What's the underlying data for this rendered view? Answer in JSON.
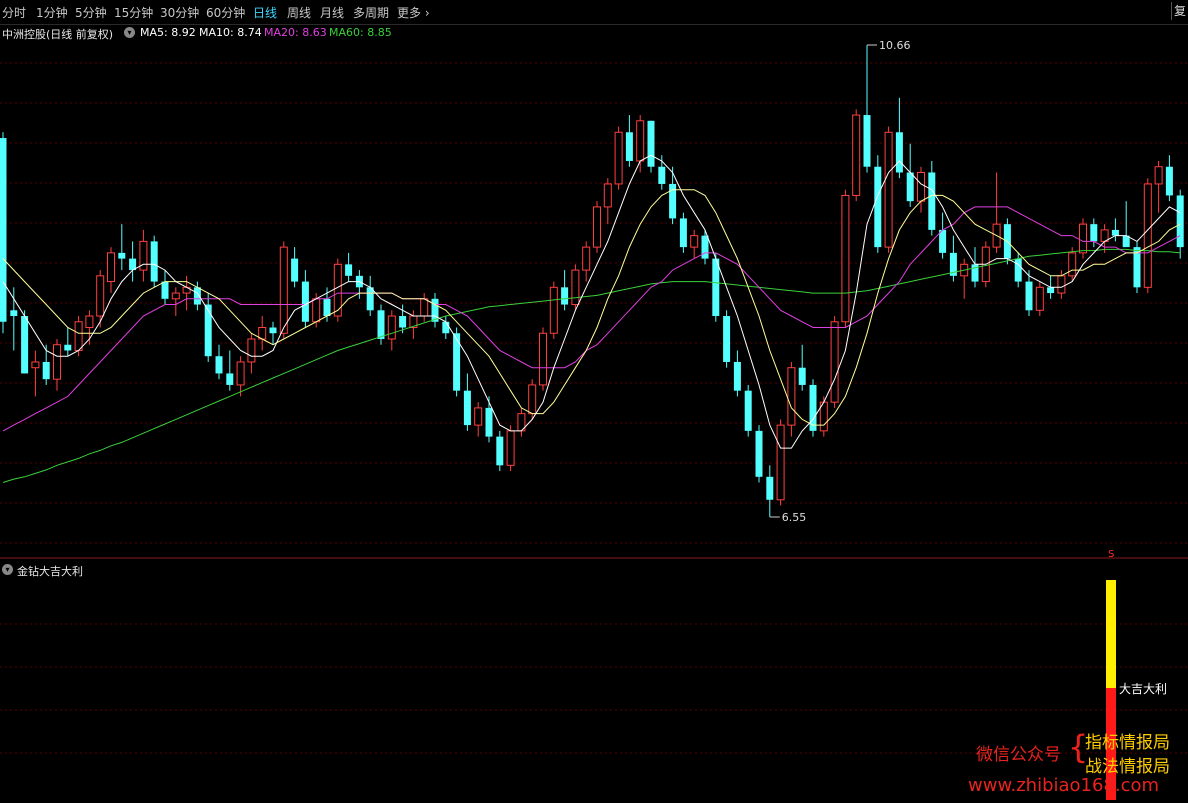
{
  "toolbar": {
    "tabs": [
      "分时",
      "1分钟",
      "5分钟",
      "15分钟",
      "30分钟",
      "60分钟",
      "日线",
      "周线",
      "月线",
      "多周期",
      "更多"
    ],
    "active_tab": "日线",
    "more_chevron": "›",
    "restore_label": "复"
  },
  "main_panel": {
    "title": "中洲控股(日线 前复权)",
    "toggle_icon": "circle-chevron-icon",
    "indicators": [
      {
        "label": "MA5: 8.92",
        "color": "#ffffff"
      },
      {
        "label": "MA10: 8.74",
        "color": "#ffffff"
      },
      {
        "label": "MA20: 8.63",
        "color": "#e040e0"
      },
      {
        "label": "MA60: 8.85",
        "color": "#3ad13a"
      }
    ],
    "high_label": "10.66",
    "low_label": "6.55"
  },
  "sub_panel": {
    "title": "金钻大吉大利",
    "signal_marker": "S",
    "bar_label": "大吉大利",
    "signal_colors": {
      "top": "#ffee00",
      "bottom": "#ff1a1a"
    }
  },
  "watermark": {
    "left": "微信公众号",
    "right_top": "指标情报局",
    "right_bottom": "战法情报局",
    "url": "www.zhibiao168.com"
  },
  "colors": {
    "up": "#ff4040",
    "down": "#54ffff",
    "ma5": "#ffffff",
    "ma10": "#ffff99",
    "ma20": "#e040e0",
    "ma60": "#3ad13a",
    "grid": "#5a0000"
  },
  "chart_data": {
    "type": "candlestick",
    "title": "中洲控股(日线 前复权)",
    "price_high": 10.66,
    "price_low": 6.55,
    "candles": [
      [
        9.85,
        9.9,
        8.15,
        8.25
      ],
      [
        8.35,
        8.55,
        8.0,
        8.3
      ],
      [
        8.3,
        8.35,
        7.8,
        7.8
      ],
      [
        7.85,
        8.0,
        7.6,
        7.9
      ],
      [
        7.9,
        8.05,
        7.7,
        7.75
      ],
      [
        7.75,
        8.1,
        7.65,
        8.05
      ],
      [
        8.05,
        8.2,
        7.95,
        8.0
      ],
      [
        8.0,
        8.3,
        7.95,
        8.25
      ],
      [
        8.2,
        8.35,
        8.05,
        8.3
      ],
      [
        8.3,
        8.7,
        8.2,
        8.65
      ],
      [
        8.6,
        8.9,
        8.5,
        8.85
      ],
      [
        8.85,
        9.1,
        8.7,
        8.8
      ],
      [
        8.8,
        8.95,
        8.6,
        8.7
      ],
      [
        8.7,
        9.05,
        8.6,
        8.95
      ],
      [
        8.95,
        9.0,
        8.55,
        8.6
      ],
      [
        8.6,
        8.7,
        8.4,
        8.45
      ],
      [
        8.45,
        8.55,
        8.3,
        8.5
      ],
      [
        8.5,
        8.65,
        8.35,
        8.55
      ],
      [
        8.55,
        8.6,
        8.35,
        8.4
      ],
      [
        8.4,
        8.5,
        7.9,
        7.95
      ],
      [
        7.95,
        8.05,
        7.75,
        7.8
      ],
      [
        7.8,
        8.0,
        7.65,
        7.7
      ],
      [
        7.7,
        7.95,
        7.6,
        7.9
      ],
      [
        7.9,
        8.15,
        7.8,
        8.1
      ],
      [
        8.1,
        8.3,
        8.0,
        8.2
      ],
      [
        8.2,
        8.25,
        8.05,
        8.15
      ],
      [
        8.15,
        8.95,
        8.1,
        8.9
      ],
      [
        8.8,
        8.9,
        8.55,
        8.6
      ],
      [
        8.6,
        8.7,
        8.2,
        8.25
      ],
      [
        8.25,
        8.5,
        8.2,
        8.45
      ],
      [
        8.45,
        8.55,
        8.25,
        8.3
      ],
      [
        8.3,
        8.8,
        8.25,
        8.75
      ],
      [
        8.75,
        8.85,
        8.6,
        8.65
      ],
      [
        8.65,
        8.7,
        8.45,
        8.55
      ],
      [
        8.55,
        8.65,
        8.3,
        8.35
      ],
      [
        8.35,
        8.4,
        8.05,
        8.1
      ],
      [
        8.1,
        8.35,
        8.0,
        8.3
      ],
      [
        8.3,
        8.4,
        8.15,
        8.2
      ],
      [
        8.2,
        8.35,
        8.1,
        8.3
      ],
      [
        8.3,
        8.5,
        8.25,
        8.45
      ],
      [
        8.45,
        8.5,
        8.2,
        8.25
      ],
      [
        8.25,
        8.3,
        8.1,
        8.15
      ],
      [
        8.15,
        8.2,
        7.6,
        7.65
      ],
      [
        7.65,
        7.8,
        7.3,
        7.35
      ],
      [
        7.35,
        7.55,
        7.25,
        7.5
      ],
      [
        7.5,
        7.6,
        7.2,
        7.25
      ],
      [
        7.25,
        7.3,
        6.95,
        7.0
      ],
      [
        7.0,
        7.35,
        6.95,
        7.3
      ],
      [
        7.3,
        7.5,
        7.25,
        7.45
      ],
      [
        7.45,
        7.75,
        7.4,
        7.7
      ],
      [
        7.7,
        8.2,
        7.65,
        8.15
      ],
      [
        8.15,
        8.6,
        8.1,
        8.55
      ],
      [
        8.55,
        8.7,
        8.35,
        8.4
      ],
      [
        8.4,
        8.75,
        8.35,
        8.7
      ],
      [
        8.7,
        8.95,
        8.6,
        8.9
      ],
      [
        8.9,
        9.3,
        8.85,
        9.25
      ],
      [
        9.25,
        9.5,
        9.1,
        9.45
      ],
      [
        9.45,
        9.95,
        9.4,
        9.9
      ],
      [
        9.9,
        10.05,
        9.6,
        9.65
      ],
      [
        9.65,
        10.05,
        9.55,
        10.0
      ],
      [
        10.0,
        10.0,
        9.55,
        9.6
      ],
      [
        9.6,
        9.7,
        9.4,
        9.45
      ],
      [
        9.45,
        9.6,
        9.1,
        9.15
      ],
      [
        9.15,
        9.2,
        8.85,
        8.9
      ],
      [
        8.9,
        9.05,
        8.8,
        9.0
      ],
      [
        9.0,
        9.05,
        8.75,
        8.8
      ],
      [
        8.8,
        8.85,
        8.25,
        8.3
      ],
      [
        8.3,
        8.35,
        7.85,
        7.9
      ],
      [
        7.9,
        8.0,
        7.6,
        7.65
      ],
      [
        7.65,
        7.7,
        7.25,
        7.3
      ],
      [
        7.3,
        7.35,
        6.85,
        6.9
      ],
      [
        6.9,
        7.0,
        6.55,
        6.7
      ],
      [
        6.7,
        7.4,
        6.65,
        7.35
      ],
      [
        7.35,
        7.9,
        7.25,
        7.85
      ],
      [
        7.85,
        8.05,
        7.65,
        7.7
      ],
      [
        7.7,
        7.75,
        7.25,
        7.3
      ],
      [
        7.3,
        7.6,
        7.25,
        7.55
      ],
      [
        7.55,
        8.3,
        7.5,
        8.25
      ],
      [
        8.25,
        9.4,
        8.2,
        9.35
      ],
      [
        9.35,
        10.1,
        9.3,
        10.05
      ],
      [
        10.05,
        10.66,
        9.55,
        9.6
      ],
      [
        9.6,
        9.7,
        8.85,
        8.9
      ],
      [
        8.9,
        9.95,
        8.85,
        9.9
      ],
      [
        9.9,
        10.2,
        9.5,
        9.55
      ],
      [
        9.55,
        9.8,
        9.25,
        9.3
      ],
      [
        9.3,
        9.6,
        9.2,
        9.55
      ],
      [
        9.55,
        9.65,
        9.0,
        9.05
      ],
      [
        9.05,
        9.2,
        8.8,
        8.85
      ],
      [
        8.85,
        9.0,
        8.6,
        8.65
      ],
      [
        8.65,
        8.8,
        8.45,
        8.75
      ],
      [
        8.75,
        8.9,
        8.55,
        8.6
      ],
      [
        8.6,
        8.95,
        8.55,
        8.9
      ],
      [
        8.9,
        9.55,
        8.85,
        9.1
      ],
      [
        9.1,
        9.15,
        8.75,
        8.8
      ],
      [
        8.8,
        8.85,
        8.55,
        8.6
      ],
      [
        8.6,
        8.7,
        8.3,
        8.35
      ],
      [
        8.35,
        8.6,
        8.3,
        8.55
      ],
      [
        8.55,
        8.65,
        8.45,
        8.5
      ],
      [
        8.5,
        8.7,
        8.45,
        8.65
      ],
      [
        8.65,
        8.9,
        8.6,
        8.85
      ],
      [
        8.85,
        9.15,
        8.8,
        9.1
      ],
      [
        9.1,
        9.15,
        8.9,
        8.95
      ],
      [
        8.95,
        9.1,
        8.85,
        9.05
      ],
      [
        9.05,
        9.15,
        8.95,
        9.0
      ],
      [
        9.0,
        9.3,
        8.95,
        8.9
      ],
      [
        8.9,
        8.95,
        8.5,
        8.55
      ],
      [
        8.55,
        9.5,
        8.5,
        9.45
      ],
      [
        9.45,
        9.65,
        9.2,
        9.6
      ],
      [
        9.6,
        9.7,
        9.3,
        9.35
      ],
      [
        9.35,
        9.4,
        8.8,
        8.9
      ]
    ],
    "ma": {
      "ma5": [
        8.6,
        8.45,
        8.3,
        8.15,
        8.0,
        7.95,
        7.95,
        8.0,
        8.1,
        8.25,
        8.45,
        8.6,
        8.7,
        8.75,
        8.75,
        8.7,
        8.6,
        8.55,
        8.5,
        8.35,
        8.2,
        8.1,
        8.0,
        7.95,
        7.95,
        8.0,
        8.2,
        8.35,
        8.4,
        8.45,
        8.5,
        8.55,
        8.6,
        8.6,
        8.55,
        8.45,
        8.4,
        8.35,
        8.3,
        8.3,
        8.3,
        8.25,
        8.1,
        7.95,
        7.75,
        7.55,
        7.35,
        7.3,
        7.3,
        7.4,
        7.55,
        7.85,
        8.1,
        8.35,
        8.55,
        8.75,
        8.95,
        9.2,
        9.45,
        9.65,
        9.7,
        9.65,
        9.55,
        9.35,
        9.2,
        9.05,
        8.8,
        8.55,
        8.3,
        8.0,
        7.7,
        7.35,
        7.15,
        7.15,
        7.3,
        7.4,
        7.55,
        7.75,
        8.0,
        8.5,
        9.1,
        9.35,
        9.55,
        9.65,
        9.55,
        9.45,
        9.4,
        9.25,
        9.05,
        8.9,
        8.75,
        8.75,
        8.8,
        8.8,
        8.75,
        8.65,
        8.6,
        8.55,
        8.55,
        8.6,
        8.75,
        8.85,
        8.95,
        9.0,
        9.0,
        8.95,
        9.05,
        9.15,
        9.25,
        9.2
      ],
      "ma10": [
        8.8,
        8.7,
        8.6,
        8.5,
        8.4,
        8.3,
        8.2,
        8.15,
        8.15,
        8.15,
        8.2,
        8.3,
        8.4,
        8.5,
        8.55,
        8.6,
        8.6,
        8.6,
        8.55,
        8.5,
        8.45,
        8.35,
        8.25,
        8.15,
        8.1,
        8.05,
        8.1,
        8.15,
        8.2,
        8.25,
        8.3,
        8.35,
        8.45,
        8.5,
        8.5,
        8.5,
        8.5,
        8.45,
        8.45,
        8.45,
        8.4,
        8.35,
        8.25,
        8.15,
        8.05,
        7.95,
        7.8,
        7.65,
        7.5,
        7.45,
        7.45,
        7.55,
        7.7,
        7.85,
        8.0,
        8.2,
        8.45,
        8.65,
        8.9,
        9.1,
        9.25,
        9.35,
        9.4,
        9.4,
        9.4,
        9.35,
        9.2,
        9.0,
        8.8,
        8.55,
        8.3,
        8.0,
        7.75,
        7.5,
        7.4,
        7.35,
        7.35,
        7.45,
        7.6,
        7.85,
        8.15,
        8.5,
        8.8,
        9.05,
        9.2,
        9.3,
        9.35,
        9.35,
        9.3,
        9.2,
        9.1,
        9.05,
        9.0,
        8.95,
        8.85,
        8.75,
        8.7,
        8.65,
        8.65,
        8.7,
        8.7,
        8.75,
        8.75,
        8.8,
        8.85,
        8.85,
        8.9,
        8.95,
        9.05,
        9.1
      ],
      "ma20": [
        7.3,
        7.35,
        7.4,
        7.45,
        7.5,
        7.55,
        7.6,
        7.7,
        7.8,
        7.9,
        8.0,
        8.1,
        8.2,
        8.3,
        8.35,
        8.4,
        8.4,
        8.45,
        8.45,
        8.45,
        8.45,
        8.45,
        8.4,
        8.4,
        8.4,
        8.4,
        8.4,
        8.4,
        8.4,
        8.45,
        8.45,
        8.5,
        8.5,
        8.5,
        8.5,
        8.5,
        8.5,
        8.45,
        8.45,
        8.45,
        8.4,
        8.4,
        8.35,
        8.3,
        8.2,
        8.1,
        8.0,
        7.95,
        7.9,
        7.85,
        7.85,
        7.85,
        7.85,
        7.9,
        8.0,
        8.05,
        8.15,
        8.25,
        8.35,
        8.45,
        8.55,
        8.6,
        8.7,
        8.75,
        8.8,
        8.85,
        8.85,
        8.8,
        8.75,
        8.65,
        8.55,
        8.45,
        8.35,
        8.3,
        8.25,
        8.2,
        8.2,
        8.2,
        8.2,
        8.25,
        8.3,
        8.4,
        8.5,
        8.6,
        8.75,
        8.85,
        8.95,
        9.05,
        9.1,
        9.2,
        9.25,
        9.25,
        9.25,
        9.25,
        9.2,
        9.15,
        9.1,
        9.05,
        9.0,
        9.0,
        8.95,
        8.95,
        8.9,
        8.9,
        8.85,
        8.85,
        8.85,
        8.9,
        8.95,
        9.0
      ],
      "ma60": [
        6.85,
        6.88,
        6.9,
        6.93,
        6.96,
        7.0,
        7.03,
        7.06,
        7.1,
        7.13,
        7.17,
        7.2,
        7.24,
        7.28,
        7.32,
        7.36,
        7.4,
        7.44,
        7.48,
        7.52,
        7.56,
        7.6,
        7.64,
        7.68,
        7.72,
        7.76,
        7.8,
        7.84,
        7.88,
        7.92,
        7.96,
        8.0,
        8.03,
        8.06,
        8.09,
        8.12,
        8.15,
        8.18,
        8.21,
        8.24,
        8.27,
        8.3,
        8.32,
        8.34,
        8.36,
        8.38,
        8.39,
        8.4,
        8.41,
        8.42,
        8.43,
        8.44,
        8.45,
        8.46,
        8.47,
        8.48,
        8.5,
        8.52,
        8.54,
        8.56,
        8.58,
        8.59,
        8.6,
        8.6,
        8.6,
        8.6,
        8.59,
        8.58,
        8.57,
        8.56,
        8.55,
        8.54,
        8.53,
        8.52,
        8.51,
        8.5,
        8.5,
        8.5,
        8.5,
        8.51,
        8.52,
        8.54,
        8.56,
        8.58,
        8.6,
        8.62,
        8.64,
        8.66,
        8.68,
        8.7,
        8.72,
        8.74,
        8.76,
        8.78,
        8.8,
        8.82,
        8.83,
        8.84,
        8.85,
        8.86,
        8.87,
        8.87,
        8.88,
        8.88,
        8.88,
        8.87,
        8.87,
        8.86,
        8.86,
        8.85
      ]
    },
    "signal": {
      "date_index": 109,
      "label": "大吉大利"
    }
  }
}
